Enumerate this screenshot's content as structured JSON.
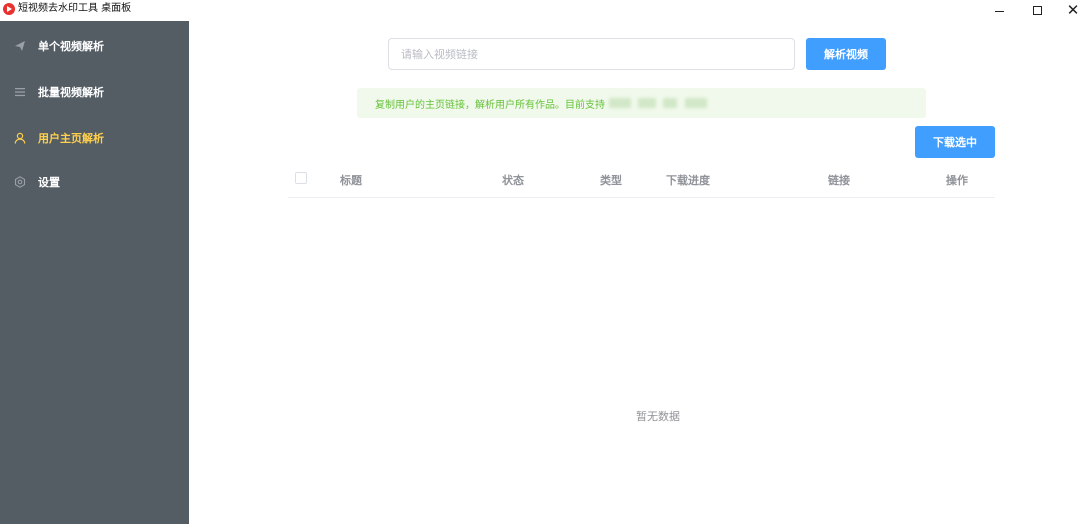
{
  "window": {
    "title": "短视频去水印工具 桌面板",
    "controls": {
      "minimize": "—",
      "maximize": "☐",
      "close": "✕"
    }
  },
  "sidebar": {
    "background": "#545c64",
    "active_color": "#ffd04b",
    "items": [
      {
        "label": "单个视频解析",
        "icon": "paper-plane-icon",
        "active": false
      },
      {
        "label": "批量视频解析",
        "icon": "list-icon",
        "active": false
      },
      {
        "label": "用户主页解析",
        "icon": "user-icon",
        "active": true
      },
      {
        "label": "设置",
        "icon": "gear-icon",
        "active": false
      }
    ]
  },
  "search": {
    "placeholder": "请输入视频链接",
    "value": "",
    "button_label": "解析视频"
  },
  "notice": {
    "text": "复制用户的主页链接，解析用户所有作品。目前支持",
    "color": "#67c23a",
    "background": "#f0f9eb"
  },
  "toolbar": {
    "download_selected_label": "下载选中"
  },
  "table": {
    "columns": [
      "标题",
      "状态",
      "类型",
      "下载进度",
      "链接",
      "操作"
    ],
    "rows": [],
    "empty_text": "暂无数据"
  },
  "colors": {
    "primary": "#409eff"
  }
}
